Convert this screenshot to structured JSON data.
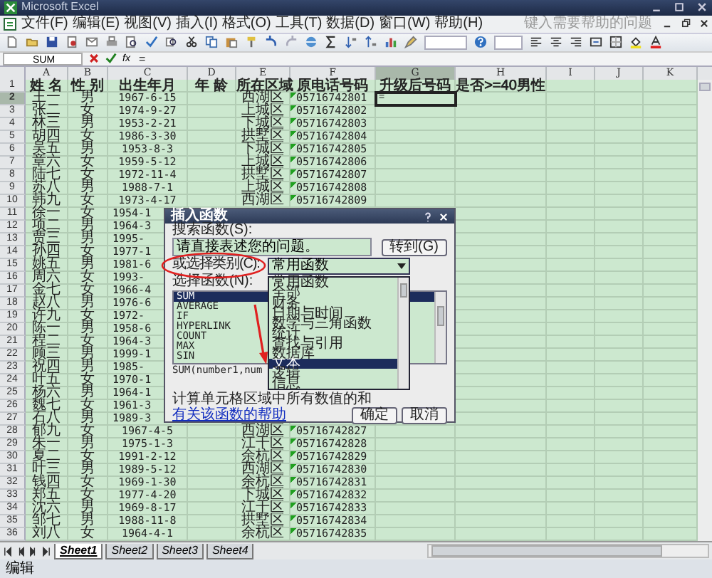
{
  "window": {
    "title": "Microsoft Excel"
  },
  "menu": [
    "文件(F)",
    "编辑(E)",
    "视图(V)",
    "插入(I)",
    "格式(O)",
    "工具(T)",
    "数据(D)",
    "窗口(W)",
    "帮助(H)"
  ],
  "help_box": {
    "placeholder": "键入需要帮助的问题"
  },
  "formula_bar": {
    "name_box": "SUM",
    "function_label": "fx",
    "formula": "="
  },
  "columns": [
    {
      "label": "A",
      "selected": false
    },
    {
      "label": "B",
      "selected": false
    },
    {
      "label": "C",
      "selected": false
    },
    {
      "label": "D",
      "selected": false
    },
    {
      "label": "E",
      "selected": false
    },
    {
      "label": "F",
      "selected": false
    },
    {
      "label": "G",
      "selected": true
    },
    {
      "label": "H",
      "selected": false
    },
    {
      "label": "I",
      "selected": false
    },
    {
      "label": "J",
      "selected": false
    },
    {
      "label": "K",
      "selected": false
    }
  ],
  "header_row": {
    "number": "1",
    "selected": false,
    "cells": [
      "姓 名",
      "性 别",
      "出生年月",
      "年 龄",
      "所在区域",
      "原电话号码",
      "升级后号码",
      "是否>=40男性"
    ]
  },
  "rows": [
    {
      "number": "2",
      "selected": true,
      "name": "王一",
      "gender": "男",
      "birth": "1967-6-15",
      "district": "西湖区",
      "phone": "05716742801",
      "upgraded": "="
    },
    {
      "number": "3",
      "selected": false,
      "name": "张二",
      "gender": "女",
      "birth": "1974-9-27",
      "district": "上城区",
      "phone": "05716742802"
    },
    {
      "number": "4",
      "selected": false,
      "name": "林三",
      "gender": "男",
      "birth": "1953-2-21",
      "district": "下城区",
      "phone": "05716742803"
    },
    {
      "number": "5",
      "selected": false,
      "name": "胡四",
      "gender": "女",
      "birth": "1986-3-30",
      "district": "拱墅区",
      "phone": "05716742804"
    },
    {
      "number": "6",
      "selected": false,
      "name": "吴五",
      "gender": "男",
      "birth": "1953-8-3",
      "district": "下城区",
      "phone": "05716742805"
    },
    {
      "number": "7",
      "selected": false,
      "name": "章六",
      "gender": "女",
      "birth": "1959-5-12",
      "district": "上城区",
      "phone": "05716742806"
    },
    {
      "number": "8",
      "selected": false,
      "name": "陆七",
      "gender": "女",
      "birth": "1972-11-4",
      "district": "拱墅区",
      "phone": "05716742807"
    },
    {
      "number": "9",
      "selected": false,
      "name": "苏八",
      "gender": "男",
      "birth": "1988-7-1",
      "district": "上城区",
      "phone": "05716742808"
    },
    {
      "number": "10",
      "selected": false,
      "name": "韩九",
      "gender": "女",
      "birth": "1973-4-17",
      "district": "西湖区",
      "phone": "05716742809"
    },
    {
      "number": "11",
      "selected": false,
      "name": "徐一",
      "gender": "女",
      "birth": "1954-1"
    },
    {
      "number": "12",
      "selected": false,
      "name": "项二",
      "gender": "男",
      "birth": "1964-3"
    },
    {
      "number": "13",
      "selected": false,
      "name": "贾三",
      "gender": "男",
      "birth": "1995-"
    },
    {
      "number": "14",
      "selected": false,
      "name": "孙四",
      "gender": "女",
      "birth": "1977-1"
    },
    {
      "number": "15",
      "selected": false,
      "name": "姚五",
      "gender": "男",
      "birth": "1981-6"
    },
    {
      "number": "16",
      "selected": false,
      "name": "周六",
      "gender": "女",
      "birth": "1993-"
    },
    {
      "number": "17",
      "selected": false,
      "name": "金七",
      "gender": "女",
      "birth": "1966-4"
    },
    {
      "number": "18",
      "selected": false,
      "name": "赵八",
      "gender": "男",
      "birth": "1976-6"
    },
    {
      "number": "19",
      "selected": false,
      "name": "许九",
      "gender": "女",
      "birth": "1972-"
    },
    {
      "number": "20",
      "selected": false,
      "name": "陈一",
      "gender": "男",
      "birth": "1958-6"
    },
    {
      "number": "21",
      "selected": false,
      "name": "程二",
      "gender": "女",
      "birth": "1964-3"
    },
    {
      "number": "22",
      "selected": false,
      "name": "顾三",
      "gender": "男",
      "birth": "1999-1"
    },
    {
      "number": "23",
      "selected": false,
      "name": "祝四",
      "gender": "男",
      "birth": "1985-"
    },
    {
      "number": "24",
      "selected": false,
      "name": "叶五",
      "gender": "女",
      "birth": "1970-1"
    },
    {
      "number": "25",
      "selected": false,
      "name": "杨六",
      "gender": "男",
      "birth": "1964-1"
    },
    {
      "number": "26",
      "selected": false,
      "name": "魏七",
      "gender": "女",
      "birth": "1961-3"
    },
    {
      "number": "27",
      "selected": false,
      "name": "石八",
      "gender": "男",
      "birth": "1989-3"
    },
    {
      "number": "28",
      "selected": false,
      "name": "郁九",
      "gender": "女",
      "birth": "1967-4-5",
      "district": "西湖区",
      "phone": "05716742827"
    },
    {
      "number": "29",
      "selected": false,
      "name": "朱一",
      "gender": "男",
      "birth": "1975-1-3",
      "district": "江干区",
      "phone": "05716742828"
    },
    {
      "number": "30",
      "selected": false,
      "name": "夏二",
      "gender": "女",
      "birth": "1991-2-12",
      "district": "余杭区",
      "phone": "05716742829"
    },
    {
      "number": "31",
      "selected": false,
      "name": "叶三",
      "gender": "男",
      "birth": "1989-5-12",
      "district": "西湖区",
      "phone": "05716742830"
    },
    {
      "number": "32",
      "selected": false,
      "name": "钱四",
      "gender": "女",
      "birth": "1969-1-30",
      "district": "余杭区",
      "phone": "05716742831"
    },
    {
      "number": "33",
      "selected": false,
      "name": "郑五",
      "gender": "女",
      "birth": "1977-4-20",
      "district": "下城区",
      "phone": "05716742832"
    },
    {
      "number": "34",
      "selected": false,
      "name": "沈六",
      "gender": "男",
      "birth": "1969-8-17",
      "district": "江干区",
      "phone": "05716742833"
    },
    {
      "number": "35",
      "selected": false,
      "name": "邹七",
      "gender": "男",
      "birth": "1988-11-8",
      "district": "拱墅区",
      "phone": "05716742834"
    },
    {
      "number": "36",
      "selected": false,
      "name": "刘八",
      "gender": "女",
      "birth": "1964-4-1",
      "district": "余杭区",
      "phone": "05716742835"
    }
  ],
  "dialog": {
    "title": "插入函数",
    "search_label": "搜索函数(S):",
    "search": {
      "value": "请直接表述您的问题。"
    },
    "go_button": "转到(G)",
    "category_label": "或选择类别(C):",
    "category": {
      "value": "常用函数",
      "expanded": true
    },
    "category_options": [
      {
        "label": "常用函数",
        "selected": false
      },
      {
        "label": "全部",
        "selected": false
      },
      {
        "label": "财务",
        "selected": false
      },
      {
        "label": "日期与时间",
        "selected": false
      },
      {
        "label": "数学与三角函数",
        "selected": false
      },
      {
        "label": "统计",
        "selected": false
      },
      {
        "label": "查找与引用",
        "selected": false
      },
      {
        "label": "数据库",
        "selected": false
      },
      {
        "label": "文本",
        "selected": true
      },
      {
        "label": "逻辑",
        "selected": false
      },
      {
        "label": "信息",
        "selected": false
      }
    ],
    "function_label": "选择函数(N):",
    "functions": [
      {
        "label": "SUM",
        "selected": true
      },
      {
        "label": "AVERAGE",
        "selected": false
      },
      {
        "label": "IF",
        "selected": false
      },
      {
        "label": "HYPERLINK",
        "selected": false
      },
      {
        "label": "COUNT",
        "selected": false
      },
      {
        "label": "MAX",
        "selected": false
      },
      {
        "label": "SIN",
        "selected": false
      }
    ],
    "signature": "SUM(number1,num",
    "description": "计算单元格区域中所有数值的和",
    "help_link": "有关该函数的帮助",
    "buttons": [
      "确定",
      "取消"
    ]
  },
  "sheet_tabs": [
    {
      "label": "Sheet1",
      "selected": true
    },
    {
      "label": "Sheet2",
      "selected": false
    },
    {
      "label": "Sheet3",
      "selected": false
    },
    {
      "label": "Sheet4",
      "selected": false
    }
  ],
  "status_bar": {
    "mode": "编辑"
  }
}
